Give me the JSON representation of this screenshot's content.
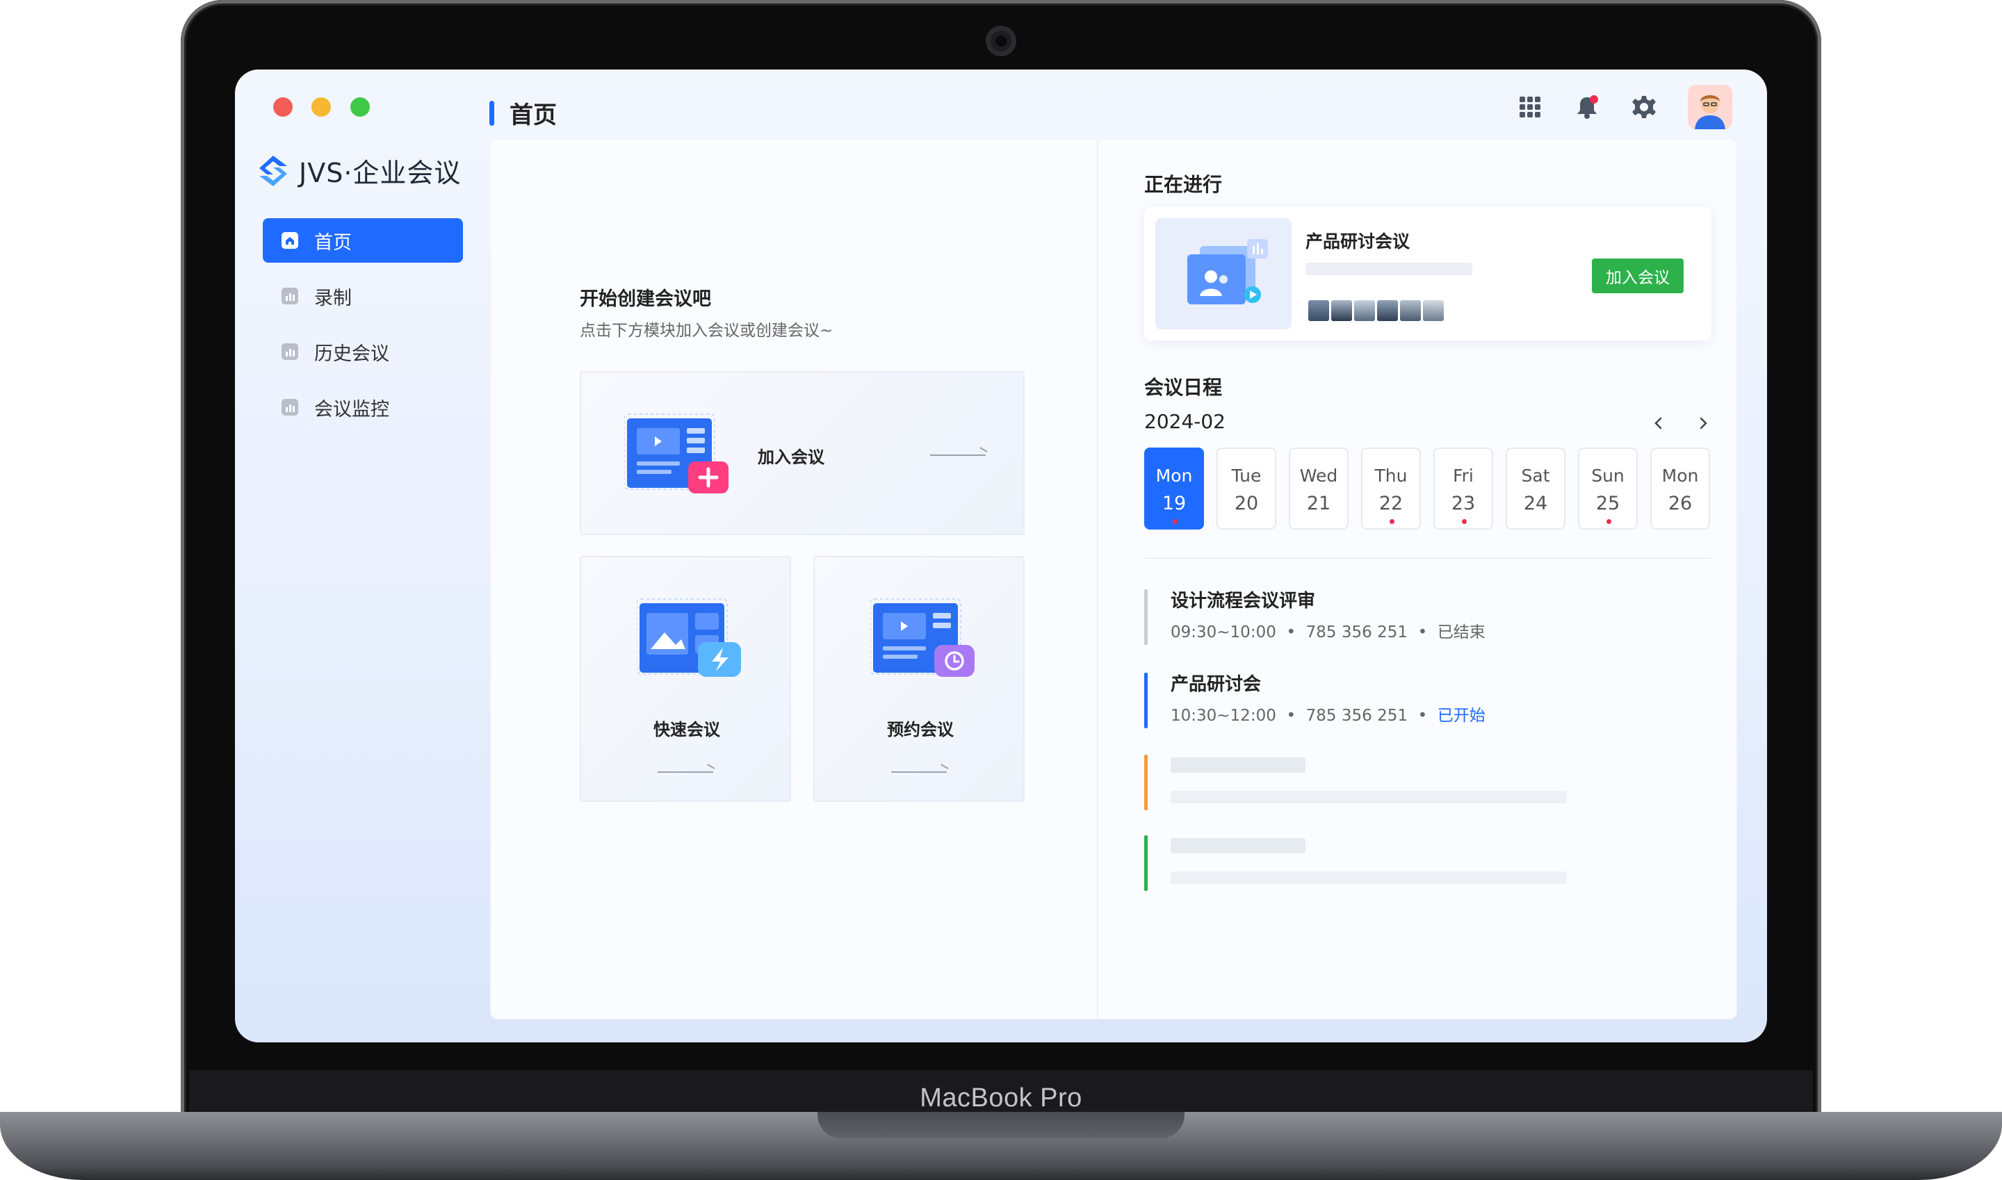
{
  "app": {
    "name": "JVS·企业会议",
    "page_title": "首页"
  },
  "device": {
    "label": "MacBook Pro"
  },
  "sidebar": {
    "items": [
      {
        "label": "首页",
        "active": true
      },
      {
        "label": "录制"
      },
      {
        "label": "历史会议"
      },
      {
        "label": "会议监控"
      }
    ]
  },
  "topbar": {
    "icons": [
      "apps-grid-icon",
      "bell-icon",
      "gear-icon",
      "avatar"
    ]
  },
  "start": {
    "title": "开始创建会议吧",
    "subtitle": "点击下方模块加入会议或创建会议~",
    "join_label": "加入会议",
    "quick_label": "快速会议",
    "book_label": "预约会议"
  },
  "ongoing": {
    "title": "正在进行",
    "meeting_name": "产品研讨会议",
    "join_button": "加入会议"
  },
  "schedule": {
    "title": "会议日程",
    "month": "2024-02",
    "days": [
      {
        "name": "Mon",
        "num": "19",
        "active": true,
        "dot": true
      },
      {
        "name": "Tue",
        "num": "20"
      },
      {
        "name": "Wed",
        "num": "21"
      },
      {
        "name": "Thu",
        "num": "22",
        "dot": true
      },
      {
        "name": "Fri",
        "num": "23",
        "dot": true
      },
      {
        "name": "Sat",
        "num": "24"
      },
      {
        "name": "Sun",
        "num": "25",
        "dot": true
      },
      {
        "name": "Mon",
        "num": "26"
      }
    ],
    "events": [
      {
        "title": "设计流程会议评审",
        "time": "09:30~10:00",
        "id": "785 356 251",
        "status": "已结束",
        "color": "#c9ccd2"
      },
      {
        "title": "产品研讨会",
        "time": "10:30~12:00",
        "id": "785 356 251",
        "status": "已开始",
        "color": "#1f6bff"
      }
    ],
    "placeholder_colors": [
      "#f59a3b",
      "#2db14b"
    ]
  },
  "colors": {
    "primary": "#1f6bff",
    "success": "#2db14b",
    "danger": "#ef2b52"
  }
}
